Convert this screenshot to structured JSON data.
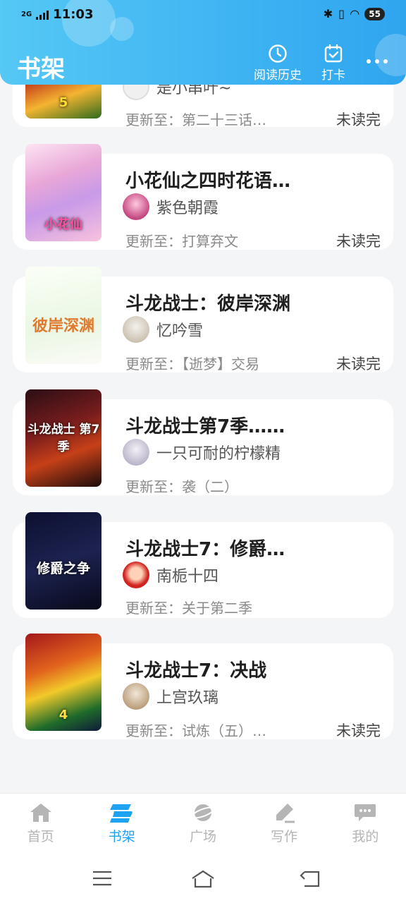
{
  "status": {
    "network": "2G",
    "time": "11:03",
    "battery": "55"
  },
  "header": {
    "title": "书架",
    "history_label": "阅读历史",
    "checkin_label": "打卡"
  },
  "books": [
    {
      "title": "",
      "author": "是小串叶~",
      "update": "更新至：第二十三话…",
      "unread": "未读完",
      "cover_text": "5"
    },
    {
      "title": "小花仙之四时花语…",
      "author": "紫色朝霞",
      "update": "更新至：打算弃文",
      "unread": "未读完",
      "cover_text": "小花仙"
    },
    {
      "title": "斗龙战士：彼岸深渊",
      "author": "忆吟雪",
      "update": "更新至：【逝梦】交易",
      "unread": "未读完",
      "cover_text": "彼岸深渊"
    },
    {
      "title": "斗龙战士第7季……",
      "author": "一只可耐的柠檬精",
      "update": "更新至：袭（二）",
      "unread": "",
      "cover_text": "斗龙战士 第7季"
    },
    {
      "title": "斗龙战士7：修爵…",
      "author": "南栀十四",
      "update": "更新至：关于第二季",
      "unread": "",
      "cover_text": "修爵之争"
    },
    {
      "title": "斗龙战士7：决战",
      "author": "上宫玖璃",
      "update": "更新至：试炼（五）…",
      "unread": "未读完",
      "cover_text": "4"
    }
  ],
  "nav": [
    {
      "label": "首页",
      "icon": "home-icon"
    },
    {
      "label": "书架",
      "icon": "bookshelf-icon"
    },
    {
      "label": "广场",
      "icon": "planet-icon"
    },
    {
      "label": "写作",
      "icon": "pen-icon"
    },
    {
      "label": "我的",
      "icon": "chat-icon"
    }
  ],
  "colors": {
    "accent": "#1da3f1",
    "header": "#3eb3f2",
    "background": "#f4f5f7"
  }
}
